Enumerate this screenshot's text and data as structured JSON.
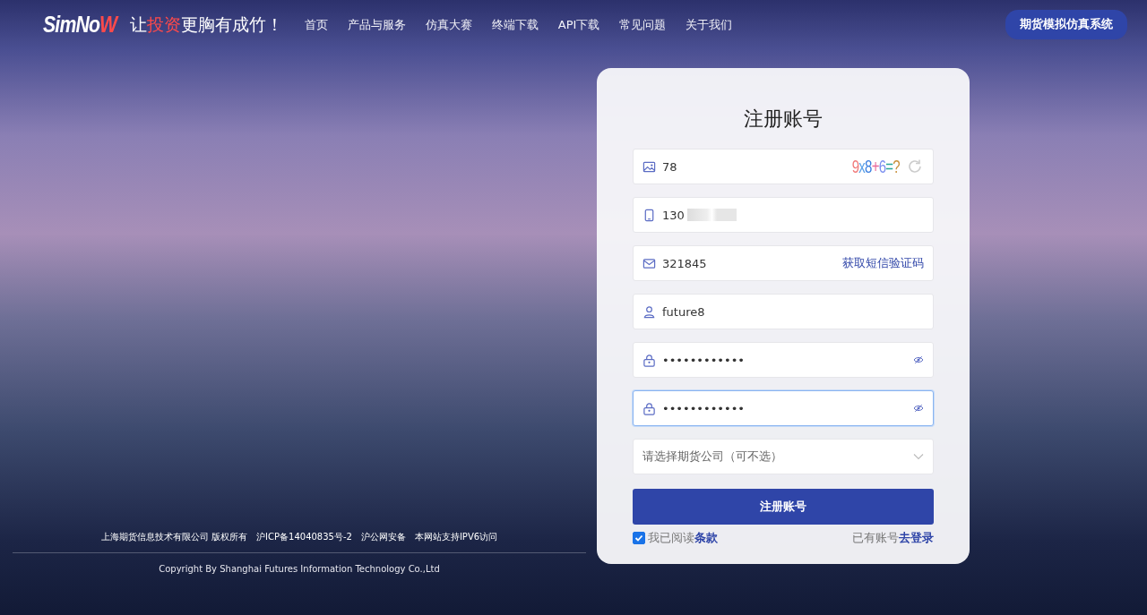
{
  "header": {
    "logo": [
      {
        "text": "SimNo",
        "highlight": false
      },
      {
        "text": "W",
        "highlight": true
      }
    ],
    "slogan": [
      {
        "text": "让",
        "highlight": false
      },
      {
        "text": "投资",
        "highlight": true
      },
      {
        "text": "更胸有成竹！",
        "highlight": false
      }
    ],
    "nav": [
      "首页",
      "产品与服务",
      "仿真大赛",
      "终端下载",
      "API下载",
      "常见问题",
      "关于我们"
    ],
    "system_button": "期货模拟仿真系统"
  },
  "form": {
    "title": "注册账号",
    "fields": [
      {
        "kind": "captcha",
        "value": "78",
        "captcha": "9x8+6=?",
        "focused": false
      },
      {
        "kind": "phone",
        "value": "130",
        "redacted": true,
        "focused": false
      },
      {
        "kind": "sms",
        "value": "321845",
        "action": "获取短信验证码",
        "focused": false
      },
      {
        "kind": "user",
        "value": "future8",
        "focused": false
      },
      {
        "kind": "password",
        "value": "••••••••••••",
        "focused": false
      },
      {
        "kind": "password",
        "value": "••••••••••••",
        "focused": true
      },
      {
        "kind": "select",
        "placeholder": "请选择期货公司（可不选）",
        "focused": false
      }
    ],
    "submit": "注册账号",
    "agree": {
      "checked": true,
      "text": "我已阅读",
      "link": "条款"
    },
    "login": {
      "text": "已有账号",
      "link": "去登录"
    }
  },
  "footer": {
    "items": [
      "上海期货信息技术有限公司 版权所有",
      "沪ICP备14040835号-2",
      "沪公网安备",
      "本网站支持IPV6访问"
    ],
    "copyright": "Copyright By Shanghai Futures Information Technology Co.,Ltd"
  }
}
